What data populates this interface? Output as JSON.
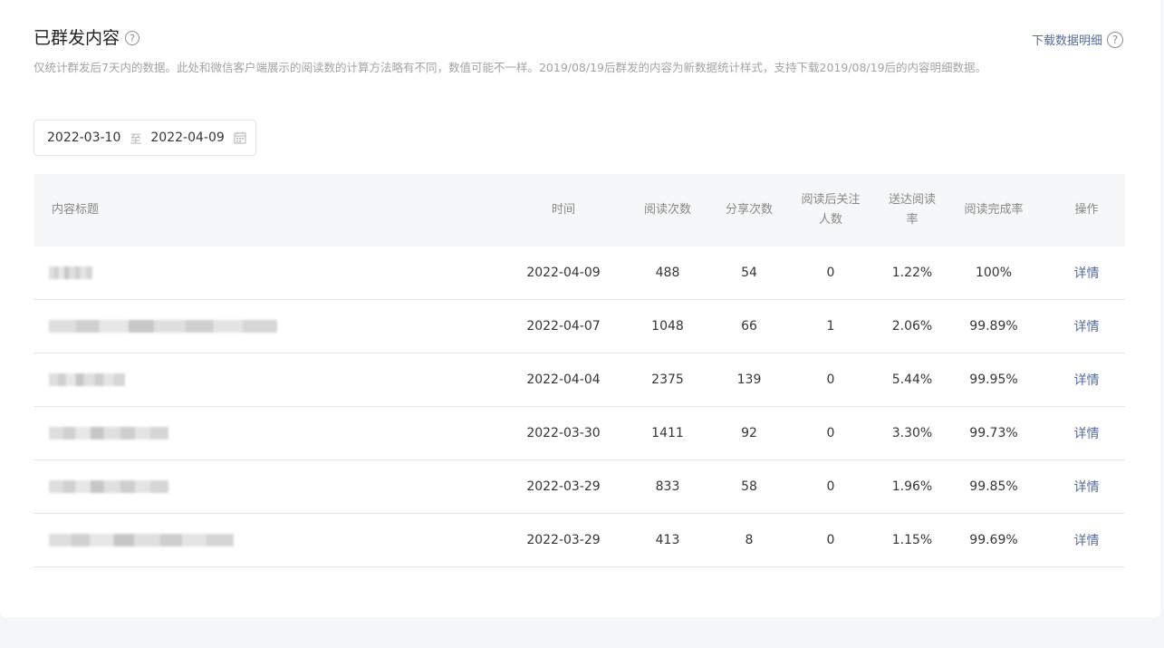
{
  "header": {
    "title": "已群发内容",
    "download_label": "下载数据明细",
    "help_glyph": "?",
    "description": "仅统计群发后7天内的数据。此处和微信客户端展示的阅读数的计算方法略有不同，数值可能不一样。2019/08/19后群发的内容为新数据统计样式，支持下载2019/08/19后的内容明细数据。"
  },
  "date_range": {
    "start": "2022-03-10",
    "separator": "至",
    "end": "2022-04-09"
  },
  "table": {
    "columns": [
      "内容标题",
      "时间",
      "阅读次数",
      "分享次数",
      "阅读后关注人数",
      "送达阅读率",
      "阅读完成率",
      "操作"
    ],
    "rows": [
      {
        "date": "2022-04-09",
        "reads": "488",
        "shares": "54",
        "follows": "0",
        "delivery_rate": "1.22%",
        "completion_rate": "100%",
        "action": "详情"
      },
      {
        "date": "2022-04-07",
        "reads": "1048",
        "shares": "66",
        "follows": "1",
        "delivery_rate": "2.06%",
        "completion_rate": "99.89%",
        "action": "详情"
      },
      {
        "date": "2022-04-04",
        "reads": "2375",
        "shares": "139",
        "follows": "0",
        "delivery_rate": "5.44%",
        "completion_rate": "99.95%",
        "action": "详情"
      },
      {
        "date": "2022-03-30",
        "reads": "1411",
        "shares": "92",
        "follows": "0",
        "delivery_rate": "3.30%",
        "completion_rate": "99.73%",
        "action": "详情"
      },
      {
        "date": "2022-03-29",
        "reads": "833",
        "shares": "58",
        "follows": "0",
        "delivery_rate": "1.96%",
        "completion_rate": "99.85%",
        "action": "详情"
      },
      {
        "date": "2022-03-29",
        "reads": "413",
        "shares": "8",
        "follows": "0",
        "delivery_rate": "1.15%",
        "completion_rate": "99.69%",
        "action": "详情"
      }
    ]
  },
  "colors": {
    "link": "#576b95",
    "muted": "#a3a3a3",
    "header_bg": "#f6f7f8"
  }
}
